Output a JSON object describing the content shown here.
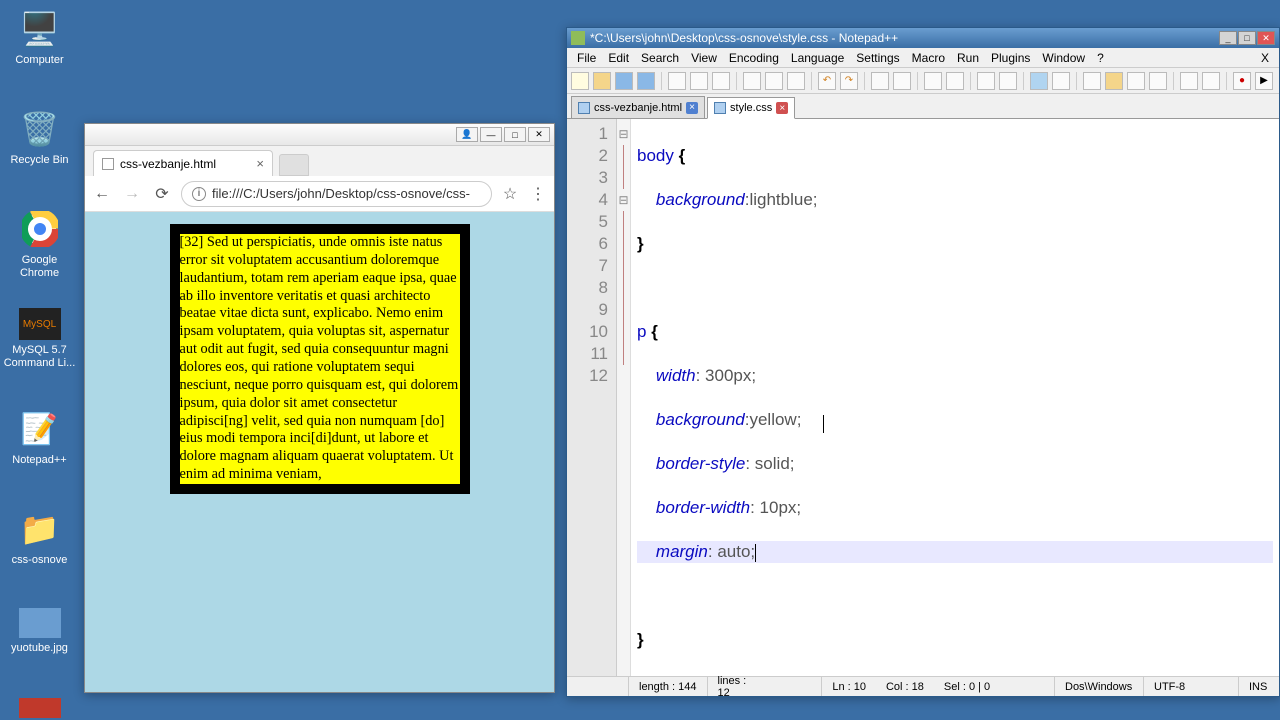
{
  "desktop": {
    "icons": [
      {
        "label": "Computer",
        "glyph": "🖥️"
      },
      {
        "label": "Recycle Bin",
        "glyph": "🗑️"
      },
      {
        "label": "Google Chrome",
        "glyph": "●"
      },
      {
        "label": "MySQL 5.7 Command Li...",
        "glyph": "🐬"
      },
      {
        "label": "Notepad++",
        "glyph": "📝"
      },
      {
        "label": "css-osnove",
        "glyph": "📁"
      },
      {
        "label": "yuotube.jpg",
        "glyph": "🖼️"
      }
    ]
  },
  "browser": {
    "tab_title": "css-vezbanje.html",
    "url": "file:///C:/Users/john/Desktop/css-osnove/css-",
    "paragraph": "[32] Sed ut perspiciatis, unde omnis iste natus error sit voluptatem accusantium doloremque laudantium, totam rem aperiam eaque ipsa, quae ab illo inventore veritatis et quasi architecto beatae vitae dicta sunt, explicabo. Nemo enim ipsam voluptatem, quia voluptas sit, aspernatur aut odit aut fugit, sed quia consequuntur magni dolores eos, qui ratione voluptatem sequi nesciunt, neque porro quisquam est, qui dolorem ipsum, quia dolor sit amet consectetur adipisci[ng] velit, sed quia non numquam [do] eius modi tempora inci[di]dunt, ut labore et dolore magnam aliquam quaerat voluptatem. Ut enim ad minima veniam,"
  },
  "npp": {
    "title": "*C:\\Users\\john\\Desktop\\css-osnove\\style.css - Notepad++",
    "menu": [
      "File",
      "Edit",
      "Search",
      "View",
      "Encoding",
      "Language",
      "Settings",
      "Macro",
      "Run",
      "Plugins",
      "Window",
      "?"
    ],
    "tabs": [
      {
        "name": "css-vezbanje.html",
        "active": false
      },
      {
        "name": "style.css",
        "active": true
      }
    ],
    "lines": [
      "1",
      "2",
      "3",
      "4",
      "5",
      "6",
      "7",
      "8",
      "9",
      "10",
      "11",
      "12"
    ],
    "code": {
      "l1_sel": "body",
      "l1_b": " {",
      "l2_prop": "background",
      "l2_val": ":lightblue;",
      "l3": "}",
      "l5_sel": "p",
      "l5_b": " {",
      "l6_prop": "width",
      "l6_val": ": 300px;",
      "l7_prop": "background",
      "l7_val": ":yellow;",
      "l8_prop": "border-style",
      "l8_val": ": solid;",
      "l9_prop": "border-width",
      "l9_val": ": 10px;",
      "l10_prop": "margin",
      "l10_val": ": auto;",
      "l12": "}"
    },
    "status": {
      "length": "length : 144",
      "lines": "lines : 12",
      "ln": "Ln : 10",
      "col": "Col : 18",
      "sel": "Sel : 0 | 0",
      "eol": "Dos\\Windows",
      "enc": "UTF-8",
      "ins": "INS"
    }
  }
}
